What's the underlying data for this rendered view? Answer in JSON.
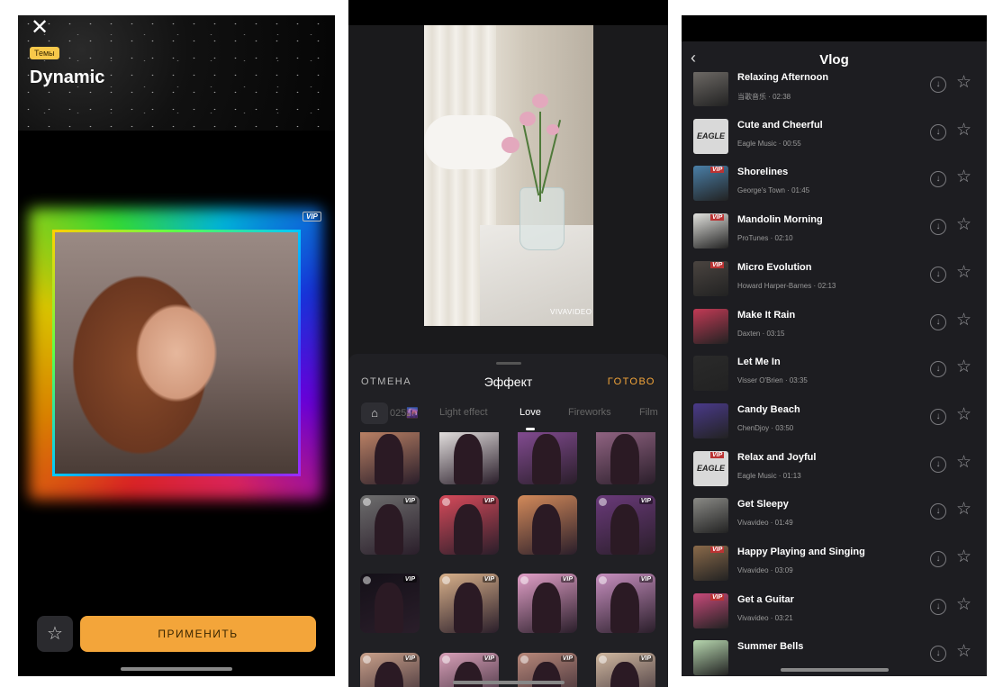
{
  "screen_theme": {
    "close_glyph": "✕",
    "badge": "Темы",
    "title": "Dynamic",
    "vip_label": "VIP",
    "apply_label": "ПРИМЕНИТЬ",
    "favorite_glyph": "☆"
  },
  "screen_effect": {
    "watermark": "VIVAVIDEO",
    "cancel_label": "ОТМЕНА",
    "title": "Эффект",
    "done_label": "ГОТОВО",
    "store_glyph": "⌂",
    "tabs": [
      {
        "label": "025🌆",
        "active": false
      },
      {
        "label": "Light effect",
        "active": false
      },
      {
        "label": "Love",
        "active": true
      },
      {
        "label": "Fireworks",
        "active": false
      },
      {
        "label": "Film",
        "active": false
      }
    ],
    "vip_label": "VIP",
    "effect_rows": [
      [
        {
          "vip": false
        },
        {
          "vip": false
        },
        {
          "vip": false
        },
        {
          "vip": false
        }
      ],
      [
        {
          "vip": true
        },
        {
          "vip": true
        },
        {
          "vip": false
        },
        {
          "vip": true
        }
      ],
      [
        {
          "vip": true
        },
        {
          "vip": true
        },
        {
          "vip": true
        },
        {
          "vip": true
        }
      ],
      [
        {
          "vip": true
        },
        {
          "vip": true
        },
        {
          "vip": true
        },
        {
          "vip": true
        }
      ]
    ],
    "accent_color": "#f3a53a"
  },
  "screen_vlog": {
    "back_glyph": "‹",
    "title": "Vlog",
    "download_glyph": "↓",
    "star_glyph": "☆",
    "vip_label": "VIP",
    "tracks": [
      {
        "name": "Relaxing Afternoon",
        "artist": "当歌音乐",
        "duration": "02:38",
        "vip": false,
        "thumb": "#6e6a66",
        "logo": ""
      },
      {
        "name": "Cute and Cheerful",
        "artist": "Eagle Music",
        "duration": "00:55",
        "vip": false,
        "thumb": "#d9d9d9",
        "logo": "EAGLE"
      },
      {
        "name": "Shorelines",
        "artist": "George's Town",
        "duration": "01:45",
        "vip": true,
        "thumb": "#4a7fa8",
        "logo": ""
      },
      {
        "name": "Mandolin Morning",
        "artist": "ProTunes",
        "duration": "02:10",
        "vip": true,
        "thumb": "#e2e2de",
        "logo": ""
      },
      {
        "name": "Micro Evolution",
        "artist": "Howard Harper-Barnes",
        "duration": "02:13",
        "vip": true,
        "thumb": "#4a4440",
        "logo": ""
      },
      {
        "name": "Make It Rain",
        "artist": "Daxten",
        "duration": "03:15",
        "vip": false,
        "thumb": "#c23a55",
        "logo": ""
      },
      {
        "name": "Let Me In",
        "artist": "Visser O'Brien",
        "duration": "03:35",
        "vip": false,
        "thumb": "#2a2a2a",
        "logo": ""
      },
      {
        "name": "Candy Beach",
        "artist": "ChenDjoy",
        "duration": "03:50",
        "vip": false,
        "thumb": "#4a3a8a",
        "logo": ""
      },
      {
        "name": "Relax and Joyful",
        "artist": "Eagle Music",
        "duration": "01:13",
        "vip": true,
        "thumb": "#d9d9d9",
        "logo": "EAGLE"
      },
      {
        "name": "Get Sleepy",
        "artist": "Vivavideo",
        "duration": "01:49",
        "vip": false,
        "thumb": "#8a8a86",
        "logo": ""
      },
      {
        "name": "Happy Playing and Singing",
        "artist": "Vivavideo",
        "duration": "03:09",
        "vip": true,
        "thumb": "#8a6a4a",
        "logo": ""
      },
      {
        "name": "Get a Guitar",
        "artist": "Vivavideo",
        "duration": "03:21",
        "vip": true,
        "thumb": "#c84a7a",
        "logo": ""
      },
      {
        "name": "Summer Bells",
        "artist": "",
        "duration": "",
        "vip": false,
        "thumb": "#b8d8b0",
        "logo": ""
      }
    ]
  }
}
